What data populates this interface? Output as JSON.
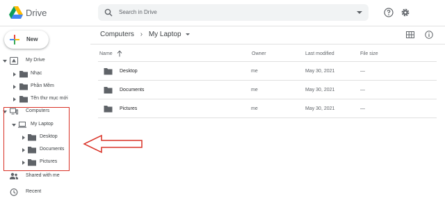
{
  "app": {
    "brand": "Drive"
  },
  "search": {
    "placeholder": "Search in Drive"
  },
  "sidebar": {
    "new_label": "New",
    "my_drive": "My Drive",
    "folders": [
      "Nhạc",
      "Phần Mềm",
      "Tên thư mục mới"
    ],
    "computers": "Computers",
    "my_laptop": "My Laptop",
    "laptop_folders": [
      "Desktop",
      "Documents",
      "Pictures"
    ],
    "shared": "Shared with me",
    "recent": "Recent"
  },
  "breadcrumb": {
    "root": "Computers",
    "separator": "›",
    "current": "My Laptop"
  },
  "table": {
    "headers": {
      "name": "Name",
      "owner": "Owner",
      "modified": "Last modified",
      "size": "File size"
    },
    "rows": [
      {
        "name": "Desktop",
        "owner": "me",
        "modified": "May 30, 2021",
        "size": "—"
      },
      {
        "name": "Documents",
        "owner": "me",
        "modified": "May 30, 2021",
        "size": "—"
      },
      {
        "name": "Pictures",
        "owner": "me",
        "modified": "May 30, 2021",
        "size": "—"
      }
    ]
  },
  "colors": {
    "highlight": "#d93025",
    "icon": "#5f6368",
    "folder": "#5f6368"
  },
  "icons": [
    "drive-logo-icon",
    "search-icon",
    "help-icon",
    "settings-icon",
    "grid-view-icon",
    "info-icon",
    "folder-icon",
    "computer-icon",
    "laptop-icon",
    "people-icon",
    "clock-icon"
  ]
}
